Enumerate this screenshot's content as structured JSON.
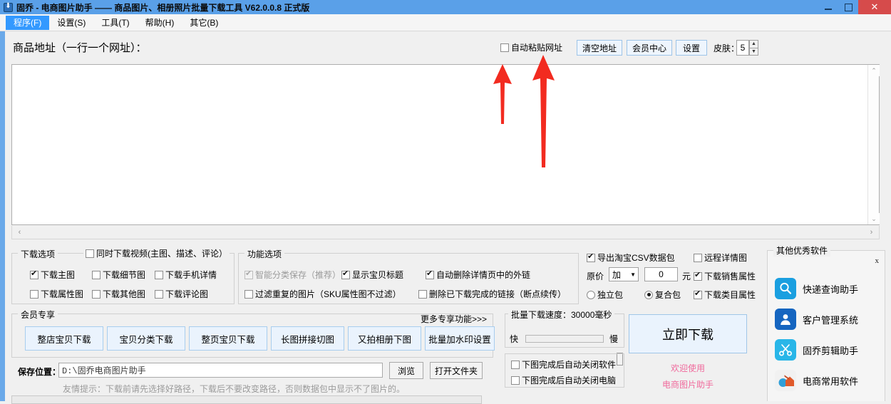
{
  "window": {
    "title": "固乔 - 电商图片助手 —— 商品图片、相册照片批量下载工具 V62.0.0.8 正式版",
    "icon": "download-app-icon",
    "minimize": "—",
    "maximize": "▢",
    "close": "✕"
  },
  "menu": {
    "items": [
      {
        "label": "程序(F)",
        "active": true
      },
      {
        "label": "设置(S)",
        "active": false
      },
      {
        "label": "工具(T)",
        "active": false
      },
      {
        "label": "帮助(H)",
        "active": false
      },
      {
        "label": "其它(B)",
        "active": false
      }
    ]
  },
  "toolbar": {
    "url_label": "商品地址（一行一个网址）：",
    "auto_paste_label": "自动粘贴网址",
    "auto_paste_checked": false,
    "clear_address": "清空地址",
    "member_center": "会员中心",
    "settings": "设置",
    "skin_label": "皮肤：",
    "skin_value": "5"
  },
  "url_textarea": {
    "value": "",
    "placeholder": ""
  },
  "download_options": {
    "title": "下载选项",
    "video_option": {
      "label": "同时下载视频(主图、描述、评论）",
      "checked": false
    },
    "items": [
      {
        "label": "下载主图",
        "checked": true,
        "disabled": false
      },
      {
        "label": "下载细节图",
        "checked": false,
        "disabled": false
      },
      {
        "label": "下载手机详情",
        "checked": false,
        "disabled": false
      },
      {
        "label": "下载属性图",
        "checked": false,
        "disabled": false
      },
      {
        "label": "下载其他图",
        "checked": false,
        "disabled": false
      },
      {
        "label": "下载评论图",
        "checked": false,
        "disabled": false
      }
    ]
  },
  "function_options": {
    "title": "功能选项",
    "items": [
      {
        "label": "智能分类保存（推荐）",
        "checked": true,
        "disabled": true
      },
      {
        "label": "显示宝贝标题",
        "checked": true,
        "disabled": false
      },
      {
        "label": "自动删除详情页中的外链",
        "checked": true,
        "disabled": false
      },
      {
        "label": "过滤重复的图片（SKU属性图不过滤）",
        "checked": false,
        "disabled": false
      },
      {
        "label": "删除已下载完成的链接（断点续传）",
        "checked": false,
        "disabled": false
      }
    ]
  },
  "csv_options": {
    "export_csv": {
      "label": "导出淘宝CSV数据包",
      "checked": true
    },
    "remote_detail": {
      "label": "远程详情图",
      "checked": false
    },
    "price_label": "原价",
    "price_mode": "加",
    "price_value": "0",
    "price_unit": "元",
    "sale_attr": {
      "label": "下载销售属性",
      "checked": true
    },
    "category_attr": {
      "label": "下载类目属性",
      "checked": true
    },
    "package_independent": {
      "label": "独立包",
      "selected": false
    },
    "package_composite": {
      "label": "复合包",
      "selected": true
    }
  },
  "member_zone": {
    "title": "会员专享",
    "more_link": "更多专享功能>>>",
    "buttons": [
      "整店宝贝下载",
      "宝贝分类下载",
      "整页宝贝下载",
      "长图拼接切图",
      "又拍相册下图",
      "批量加水印设置"
    ]
  },
  "speed_panel": {
    "title": "批量下载速度：30000毫秒",
    "fast_label": "快",
    "slow_label": "慢",
    "slider_value": 30000,
    "slider_percent": 92
  },
  "after_download": {
    "close_software": {
      "label": "下图完成后自动关闭软件",
      "checked": false
    },
    "close_computer": {
      "label": "下图完成后自动关闭电脑",
      "checked": false
    }
  },
  "download_action": {
    "button_label": "立即下载",
    "welcome_line1": "欢迎使用",
    "welcome_line2": "电商图片助手"
  },
  "save_path": {
    "label": "保存位置：",
    "value": "D:\\固乔电商图片助手",
    "browse": "浏览",
    "open_folder": "打开文件夹",
    "tip": "友情提示：下载前请先选择好路径，下载后不要改变路径，否则数据包中显示不了图片的。"
  },
  "sidebar": {
    "title": "其他优秀软件",
    "close_label": "x",
    "items": [
      {
        "label": "快递查询助手",
        "icon": "express-search-icon",
        "color": "#1a9fe0"
      },
      {
        "label": "客户管理系统",
        "icon": "customer-manage-icon",
        "color": "#1565c0"
      },
      {
        "label": "固乔剪辑助手",
        "icon": "scissors-edit-icon",
        "color": "#29b6e8"
      },
      {
        "label": "电商常用软件",
        "icon": "ecommerce-tools-icon",
        "color": "#e05a2b"
      }
    ]
  },
  "annotations": {
    "arrow_color": "#f22b20",
    "arrows": [
      {
        "name": "arrow-auto-paste-checkbox"
      },
      {
        "name": "arrow-auto-paste-label"
      }
    ]
  }
}
